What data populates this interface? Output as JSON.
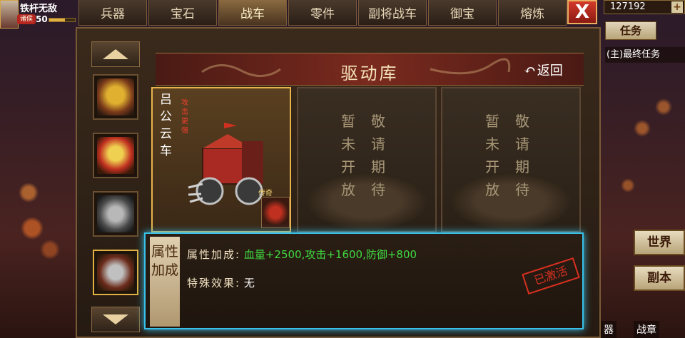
{
  "player": {
    "name": "铁杆无敌",
    "level": "50",
    "badge": "诸侯",
    "exp_fraction": 0.6
  },
  "tabs": [
    {
      "label": "兵器"
    },
    {
      "label": "宝石"
    },
    {
      "label": "战车"
    },
    {
      "label": "零件"
    },
    {
      "label": "副将战车"
    },
    {
      "label": "御宝"
    },
    {
      "label": "熔炼"
    }
  ],
  "active_tab": "战车",
  "close_label": "X",
  "hud": {
    "gold": "127192",
    "plus": "+",
    "quest_button": "任务",
    "quest_text": "(主)最终任务",
    "world_button": "世界",
    "dungeon_button": "副本",
    "bottom_left": "器",
    "bottom_right": "战章"
  },
  "panel": {
    "title": "驱动库",
    "back_label": "返回",
    "slots": [
      {
        "name_vertical": "吕公云车",
        "tag": "攻击更强",
        "badge": "传奇"
      },
      {
        "col_a": "暂未开放",
        "col_b": "敬请期待"
      },
      {
        "col_a": "暂未开放",
        "col_b": "敬请期待"
      }
    ],
    "attributes": {
      "side_label": "属性加成",
      "row1_key": "属性加成:",
      "row1_value": "血量+2500,攻击+1600,防御+800",
      "row2_key": "特殊效果:",
      "row2_value": "无",
      "stamp": "已激活"
    }
  },
  "colors": {
    "accent_border": "#e8b44a",
    "highlight": "#38c0e8",
    "bonus_text": "#40d840",
    "close": "#d43a2a"
  }
}
